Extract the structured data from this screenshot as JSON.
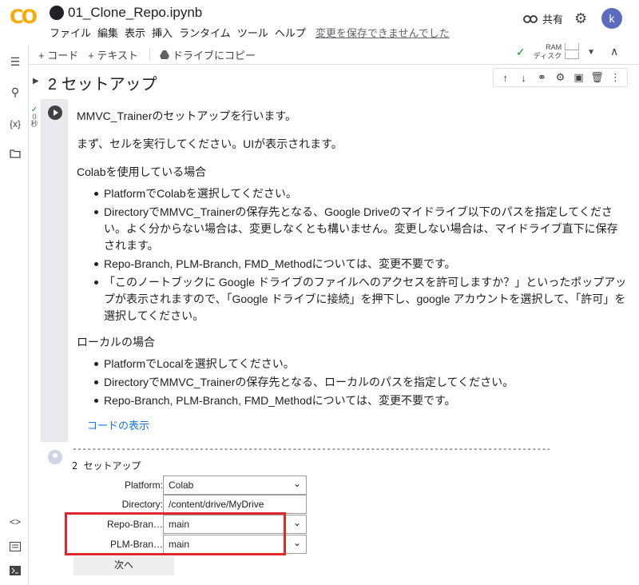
{
  "app": {
    "title": "01_Clone_Repo.ipynb",
    "menu": [
      "ファイル",
      "編集",
      "表示",
      "挿入",
      "ランタイム",
      "ツール",
      "ヘルプ"
    ],
    "unsaved": "変更を保存できませんでした",
    "share_label": "共有",
    "avatar_letter": "k",
    "logo": "CO"
  },
  "toolbar": {
    "add_code": "+ コード",
    "add_text": "+ テキスト",
    "copy_drive": "ドライブにコピー",
    "ram_label": "RAM",
    "disk_label": "ディスク"
  },
  "cell": {
    "section_title": "2 セットアップ",
    "run_status_line1": "0",
    "run_status_line2": "秒",
    "intro": "MMVC_Trainerのセットアップを行います。",
    "step1": "まず、セルを実行してください。UIが表示されます。",
    "colab_heading": "Colabを使用している場合",
    "colab_items": [
      "PlatformでColabを選択してください。",
      "DirectoryでMMVC_Trainerの保存先となる、Google Driveのマイドライブ以下のパスを指定してください。よく分からない場合は、変更しなくとも構いません。変更しない場合は、マイドライブ直下に保存されます。",
      "Repo-Branch, PLM-Branch, FMD_Methodについては、変更不要です。",
      "「このノートブックに Google ドライブのファイルへのアクセスを許可しますか？」といったポップアップが表示されますので、「Google ドライブに接続」を押下し、google アカウントを選択して、「許可」を選択してください。"
    ],
    "local_heading": "ローカルの場合",
    "local_items": [
      "PlatformでLocalを選択してください。",
      "DirectoryでMMVC_Trainerの保存先となる、ローカルのパスを指定してください。",
      "Repo-Branch, PLM-Branch, FMD_Methodについては、変更不要です。"
    ],
    "show_code": "コードの表示"
  },
  "output": {
    "dashes": "----------------------------------------------------------------------------------------------------------------------------",
    "title": "2 セットアップ",
    "platform_label": "Platform:",
    "platform_value": "Colab",
    "directory_label": "Directory:",
    "directory_value": "/content/drive/MyDrive",
    "repo_label": "Repo-Bran…",
    "repo_value": "main",
    "plm_label": "PLM-Bran…",
    "plm_value": "main",
    "next_label": "次へ"
  },
  "colors": {
    "accent": "#1a73e8",
    "highlight": "#e0282e",
    "logo": "#f9ab00"
  }
}
